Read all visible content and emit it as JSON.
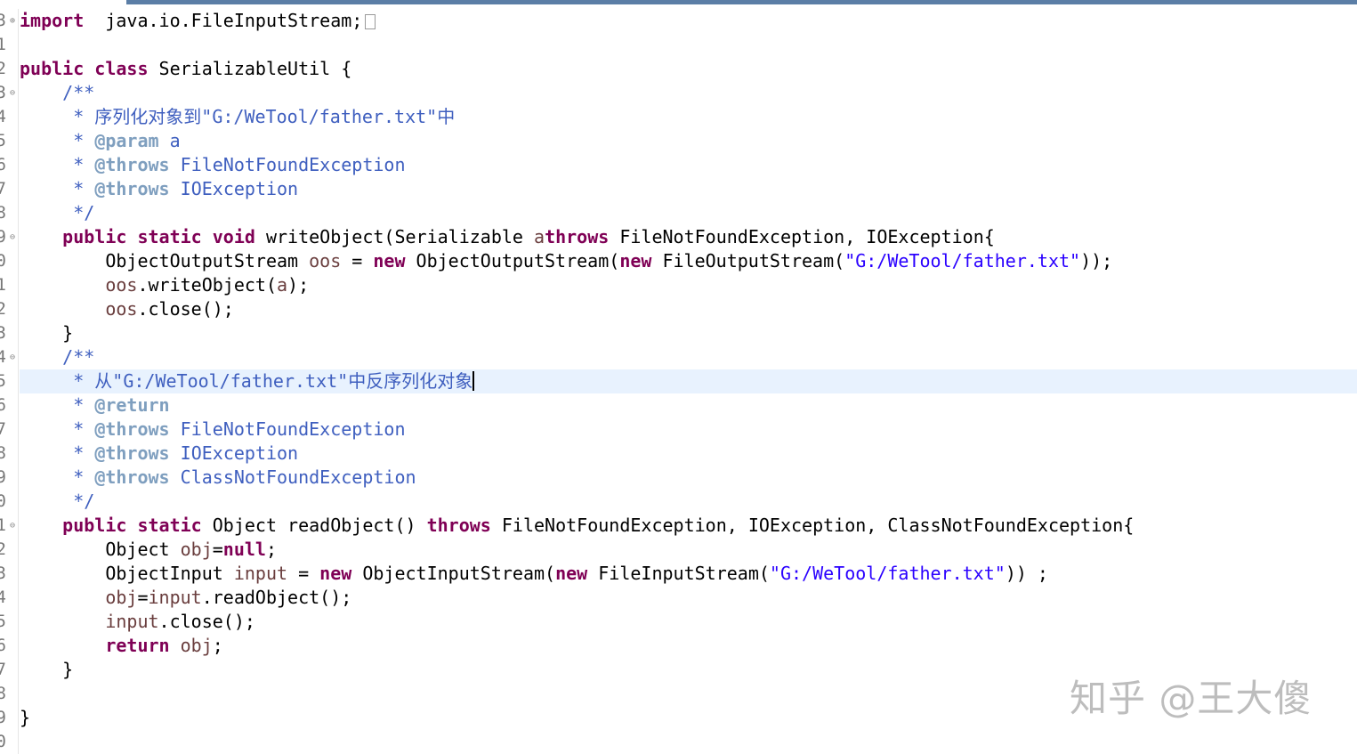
{
  "gutter": [
    {
      "num": "3",
      "fold": "⊕"
    },
    {
      "num": "1",
      "fold": ""
    },
    {
      "num": "2",
      "fold": ""
    },
    {
      "num": "3",
      "fold": "⊖"
    },
    {
      "num": "4",
      "fold": ""
    },
    {
      "num": "5",
      "fold": ""
    },
    {
      "num": "6",
      "fold": ""
    },
    {
      "num": "7",
      "fold": ""
    },
    {
      "num": "8",
      "fold": ""
    },
    {
      "num": "9",
      "fold": "⊖"
    },
    {
      "num": "0",
      "fold": ""
    },
    {
      "num": "1",
      "fold": ""
    },
    {
      "num": "2",
      "fold": ""
    },
    {
      "num": "3",
      "fold": ""
    },
    {
      "num": "4",
      "fold": "⊖"
    },
    {
      "num": "5",
      "fold": ""
    },
    {
      "num": "6",
      "fold": ""
    },
    {
      "num": "7",
      "fold": ""
    },
    {
      "num": "8",
      "fold": ""
    },
    {
      "num": "9",
      "fold": ""
    },
    {
      "num": "0",
      "fold": ""
    },
    {
      "num": "1",
      "fold": "⊖"
    },
    {
      "num": "2",
      "fold": ""
    },
    {
      "num": "3",
      "fold": ""
    },
    {
      "num": "4",
      "fold": ""
    },
    {
      "num": "5",
      "fold": ""
    },
    {
      "num": "6",
      "fold": ""
    },
    {
      "num": "7",
      "fold": ""
    },
    {
      "num": "8",
      "fold": ""
    },
    {
      "num": "9",
      "fold": ""
    },
    {
      "num": "0",
      "fold": ""
    }
  ],
  "current_line": 15,
  "cursor_line": 15,
  "collapsed_marker_line": 0,
  "lines": [
    [
      [
        "kw",
        "import"
      ],
      [
        "",
        "  java.io.FileInputStream;"
      ]
    ],
    [],
    [
      [
        "kw",
        "public"
      ],
      [
        "",
        " "
      ],
      [
        "kw",
        "class"
      ],
      [
        "",
        " SerializableUtil {"
      ]
    ],
    [
      [
        "",
        "    "
      ],
      [
        "cm",
        "/**"
      ]
    ],
    [
      [
        "",
        "     "
      ],
      [
        "cm",
        "* 序列化对象到\"G:/WeTool/father.txt\"中"
      ]
    ],
    [
      [
        "",
        "     "
      ],
      [
        "cm",
        "* "
      ],
      [
        "tag",
        "@param"
      ],
      [
        "cm",
        " a"
      ]
    ],
    [
      [
        "",
        "     "
      ],
      [
        "cm",
        "* "
      ],
      [
        "tag",
        "@throws"
      ],
      [
        "cm",
        " FileNotFoundException"
      ]
    ],
    [
      [
        "",
        "     "
      ],
      [
        "cm",
        "* "
      ],
      [
        "tag",
        "@throws"
      ],
      [
        "cm",
        " IOException"
      ]
    ],
    [
      [
        "",
        "     "
      ],
      [
        "cm",
        "*/"
      ]
    ],
    [
      [
        "",
        "    "
      ],
      [
        "kw",
        "public"
      ],
      [
        "",
        " "
      ],
      [
        "kw",
        "static"
      ],
      [
        "",
        " "
      ],
      [
        "kw",
        "void"
      ],
      [
        "",
        " writeObject(Serializable "
      ],
      [
        "fld",
        "a"
      ],
      [
        ") "
      ],
      [
        "kw",
        "throws"
      ],
      [
        "",
        " FileNotFoundException, IOException{"
      ]
    ],
    [
      [
        "",
        "        ObjectOutputStream "
      ],
      [
        "fld",
        "oos"
      ],
      [
        "",
        " = "
      ],
      [
        "kw",
        "new"
      ],
      [
        "",
        " ObjectOutputStream("
      ],
      [
        "kw",
        "new"
      ],
      [
        "",
        " FileOutputStream("
      ],
      [
        "str",
        "\"G:/WeTool/father.txt\""
      ],
      [
        "",
        "));"
      ]
    ],
    [
      [
        "",
        "        "
      ],
      [
        "fld",
        "oos"
      ],
      [
        "",
        ".writeObject("
      ],
      [
        "fld",
        "a"
      ],
      [
        "",
        ");"
      ]
    ],
    [
      [
        "",
        "        "
      ],
      [
        "fld",
        "oos"
      ],
      [
        "",
        ".close();"
      ]
    ],
    [
      [
        "",
        "    }"
      ]
    ],
    [
      [
        "",
        "    "
      ],
      [
        "cm",
        "/**"
      ]
    ],
    [
      [
        "",
        "     "
      ],
      [
        "cm",
        "* 从\"G:/WeTool/father.txt\"中反序列化对象"
      ]
    ],
    [
      [
        "",
        "     "
      ],
      [
        "cm",
        "* "
      ],
      [
        "tag",
        "@return"
      ]
    ],
    [
      [
        "",
        "     "
      ],
      [
        "cm",
        "* "
      ],
      [
        "tag",
        "@throws"
      ],
      [
        "cm",
        " FileNotFoundException"
      ]
    ],
    [
      [
        "",
        "     "
      ],
      [
        "cm",
        "* "
      ],
      [
        "tag",
        "@throws"
      ],
      [
        "cm",
        " IOException"
      ]
    ],
    [
      [
        "",
        "     "
      ],
      [
        "cm",
        "* "
      ],
      [
        "tag",
        "@throws"
      ],
      [
        "cm",
        " ClassNotFoundException"
      ]
    ],
    [
      [
        "",
        "     "
      ],
      [
        "cm",
        "*/"
      ]
    ],
    [
      [
        "",
        "    "
      ],
      [
        "kw",
        "public"
      ],
      [
        "",
        " "
      ],
      [
        "kw",
        "static"
      ],
      [
        "",
        " Object readObject() "
      ],
      [
        "kw",
        "throws"
      ],
      [
        "",
        " FileNotFoundException, IOException, ClassNotFoundException{"
      ]
    ],
    [
      [
        "",
        "        Object "
      ],
      [
        "fld",
        "obj"
      ],
      [
        "",
        "="
      ],
      [
        "kw",
        "null"
      ],
      [
        "",
        ";"
      ]
    ],
    [
      [
        "",
        "        ObjectInput "
      ],
      [
        "fld",
        "input"
      ],
      [
        "",
        " = "
      ],
      [
        "kw",
        "new"
      ],
      [
        "",
        " ObjectInputStream("
      ],
      [
        "kw",
        "new"
      ],
      [
        "",
        " FileInputStream("
      ],
      [
        "str",
        "\"G:/WeTool/father.txt\""
      ],
      [
        "",
        ")) ;"
      ]
    ],
    [
      [
        "",
        "        "
      ],
      [
        "fld",
        "obj"
      ],
      [
        "",
        "="
      ],
      [
        "fld",
        "input"
      ],
      [
        "",
        ".readObject();"
      ]
    ],
    [
      [
        "",
        "        "
      ],
      [
        "fld",
        "input"
      ],
      [
        "",
        ".close();"
      ]
    ],
    [
      [
        "",
        "        "
      ],
      [
        "kw",
        "return"
      ],
      [
        "",
        " "
      ],
      [
        "fld",
        "obj"
      ],
      [
        "",
        ";"
      ]
    ],
    [
      [
        "",
        "    }"
      ]
    ],
    [],
    [
      [
        "",
        "}"
      ]
    ],
    []
  ],
  "watermark": "知乎 @王大傻",
  "colors": {
    "keyword": "#7f0055",
    "comment": "#3f5fbf",
    "javadoc_tag": "#7f9fbf",
    "string": "#2a00ff",
    "variable": "#6a3e3e",
    "current_line_bg": "#e8f2fe",
    "tab_active": "#5b7ea6"
  }
}
